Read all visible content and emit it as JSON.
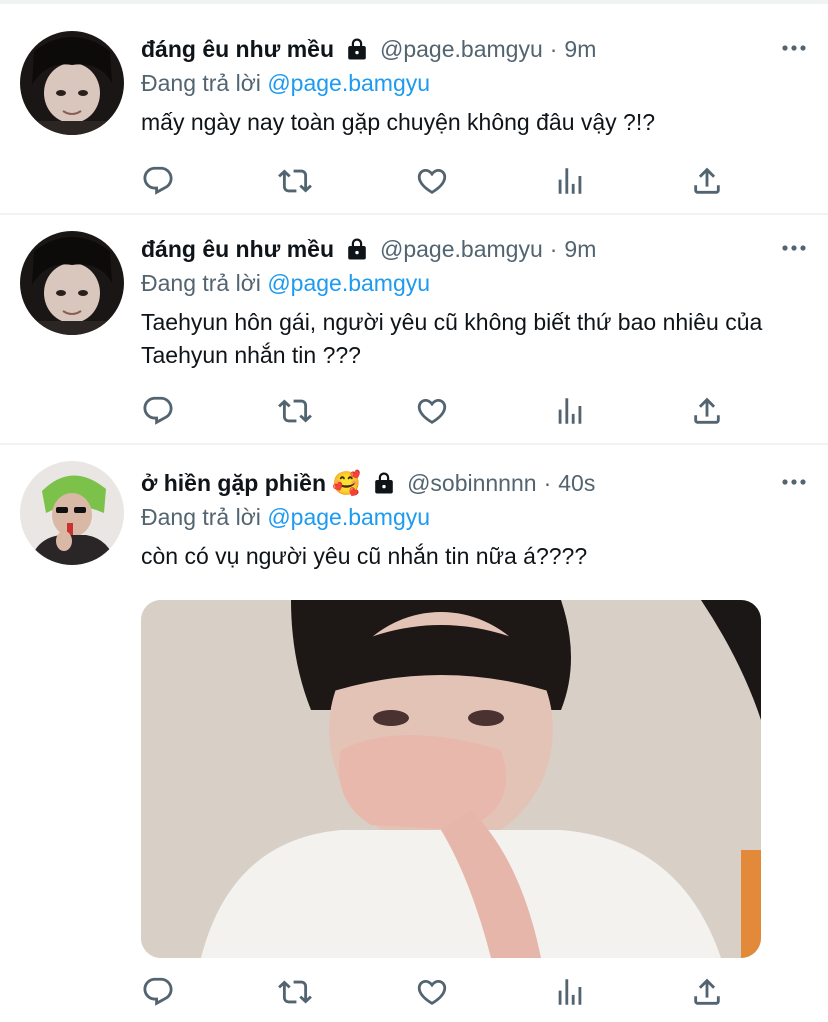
{
  "tweets": [
    {
      "name": "đáng êu như mều",
      "handle": "@page.bamgyu",
      "time": "9m",
      "replying_prefix": "Đang trả lời",
      "replying_to": "@page.bamgyu",
      "text": "mấy ngày nay toàn gặp chuyện không đâu vậy ?!?",
      "locked": true
    },
    {
      "name": "đáng êu như mều",
      "handle": "@page.bamgyu",
      "time": "9m",
      "replying_prefix": "Đang trả lời",
      "replying_to": "@page.bamgyu",
      "text": "Taehyun hôn gái, người yêu cũ không biết thứ bao nhiêu của Taehyun nhắn tin ???",
      "locked": true
    },
    {
      "name": "ở hiền gặp phiền 🥰",
      "handle": "@sobinnnnn",
      "time": "40s",
      "replying_prefix": "Đang trả lời",
      "replying_to": "@page.bamgyu",
      "text": "còn có vụ người yêu cũ nhắn tin nữa á????",
      "locked": true,
      "has_media": true
    }
  ],
  "separator": "·",
  "icons": [
    "reply-icon",
    "retweet-icon",
    "like-icon",
    "analytics-icon",
    "share-icon",
    "more-icon",
    "lock-icon"
  ],
  "colors": {
    "accent": "#1d9bf0",
    "secondary_text": "#536471",
    "divider": "#eff3f4"
  }
}
